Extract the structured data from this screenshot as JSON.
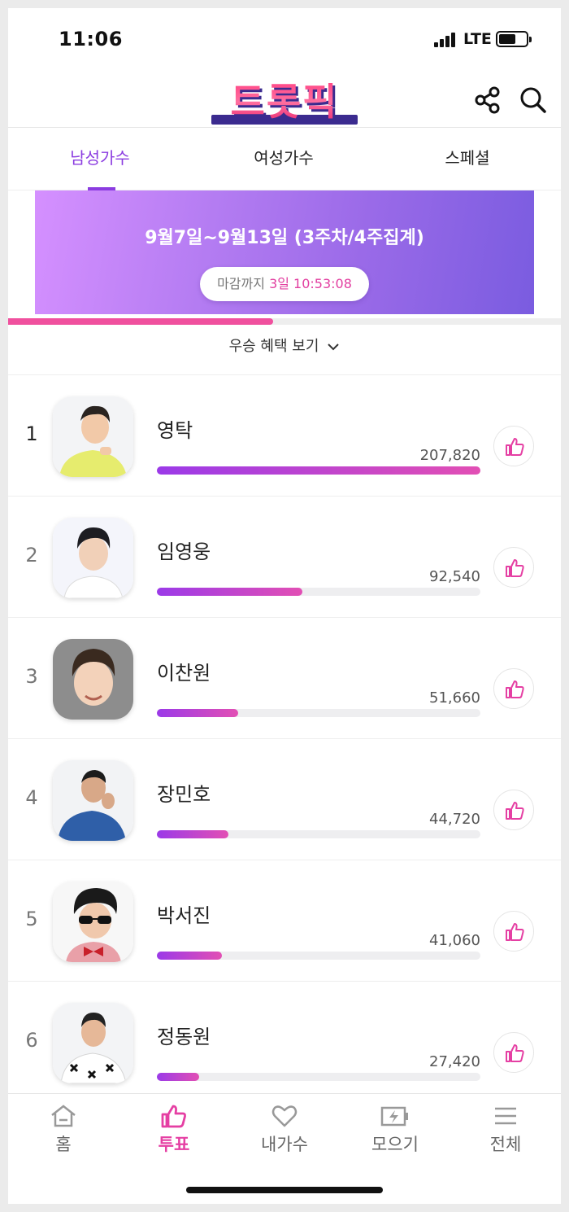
{
  "status_bar": {
    "time": "11:06",
    "network": "LTE"
  },
  "header": {
    "logo_text": "트롯픽",
    "icons": [
      "share-icon",
      "search-icon"
    ]
  },
  "tabs": [
    {
      "label": "남성가수",
      "active": true
    },
    {
      "label": "여성가수",
      "active": false
    },
    {
      "label": "스페셜",
      "active": false
    }
  ],
  "banner": {
    "period": "9월7일~9월13일 (3주차/4주집계)",
    "deadline_label": "마감까지",
    "deadline_value": "3일 10:53:08"
  },
  "week_progress": 0.48,
  "benefit_label": "우승 혜택 보기",
  "ranking": [
    {
      "rank": "1",
      "name": "영탁",
      "votes": "207,820",
      "share": 1.0
    },
    {
      "rank": "2",
      "name": "임영웅",
      "votes": "92,540",
      "share": 0.45
    },
    {
      "rank": "3",
      "name": "이찬원",
      "votes": "51,660",
      "share": 0.25
    },
    {
      "rank": "4",
      "name": "장민호",
      "votes": "44,720",
      "share": 0.22
    },
    {
      "rank": "5",
      "name": "박서진",
      "votes": "41,060",
      "share": 0.2
    },
    {
      "rank": "6",
      "name": "정동원",
      "votes": "27,420",
      "share": 0.13
    }
  ],
  "bottom_nav": [
    {
      "label": "홈",
      "icon": "home-icon",
      "active": false
    },
    {
      "label": "투표",
      "icon": "thumbs-up-icon",
      "active": true
    },
    {
      "label": "내가수",
      "icon": "heart-icon",
      "active": false
    },
    {
      "label": "모으기",
      "icon": "charge-icon",
      "active": false
    },
    {
      "label": "전체",
      "icon": "menu-icon",
      "active": false
    }
  ],
  "colors": {
    "accent_purple": "#8b3ce0",
    "accent_pink": "#e53fa3",
    "bar_start": "#9b3ae8",
    "bar_end": "#e24fb4"
  }
}
